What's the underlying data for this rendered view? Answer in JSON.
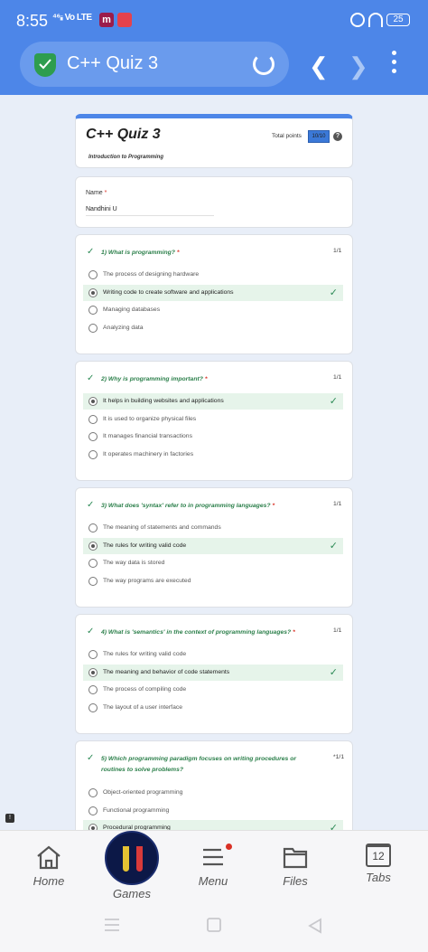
{
  "status_bar": {
    "time": "8:55",
    "network": "⁴⁶ᵢᵢᵢ Vo LTE",
    "battery": "25"
  },
  "browser": {
    "page_title": "C++ Quiz 3"
  },
  "form": {
    "title": "C++ Quiz 3",
    "subtitle": "Introduction to Programming",
    "total_points_label": "Total points",
    "score": "10/10",
    "help": "?"
  },
  "name_field": {
    "label": "Name",
    "required_mark": "*",
    "value": "Nandhini U"
  },
  "questions": [
    {
      "text": "1)  What is programming?",
      "required": "*",
      "points": "1/1",
      "options": [
        "The process of designing hardware",
        "Writing code to create software and applications",
        "Managing databases",
        "Analyzing data"
      ],
      "selected": 1
    },
    {
      "text": "2)  Why is programming important?",
      "required": "*",
      "points": "1/1",
      "options": [
        "It helps in building websites and applications",
        "It is used to organize physical files",
        "It manages financial transactions",
        "It operates machinery in factories"
      ],
      "selected": 0
    },
    {
      "text": "3)  What does 'syntax' refer to in programming languages?",
      "required": "*",
      "points": "1/1",
      "options": [
        "The meaning of statements and commands",
        "The rules for writing valid code",
        "The way data is stored",
        "The way programs are executed"
      ],
      "selected": 1
    },
    {
      "text": "4)  What is 'semantics' in the context of programming languages?",
      "required": "*",
      "points": "1/1",
      "options": [
        "The rules for writing valid code",
        "The meaning and behavior of code statements",
        "The process of compiling code",
        "The layout of a user interface"
      ],
      "selected": 1
    },
    {
      "text": "5)  Which programming paradigm focuses on writing procedures or routines to solve problems?",
      "required": "",
      "points": "*1/1",
      "options": [
        "Object-oriented programming",
        "Functional programming",
        "Procedural programming"
      ],
      "selected": 2
    }
  ],
  "bottom_nav": {
    "home": "Home",
    "games": "Games",
    "menu": "Menu",
    "files": "Files",
    "tabs": "Tabs",
    "tabs_count": "12"
  }
}
